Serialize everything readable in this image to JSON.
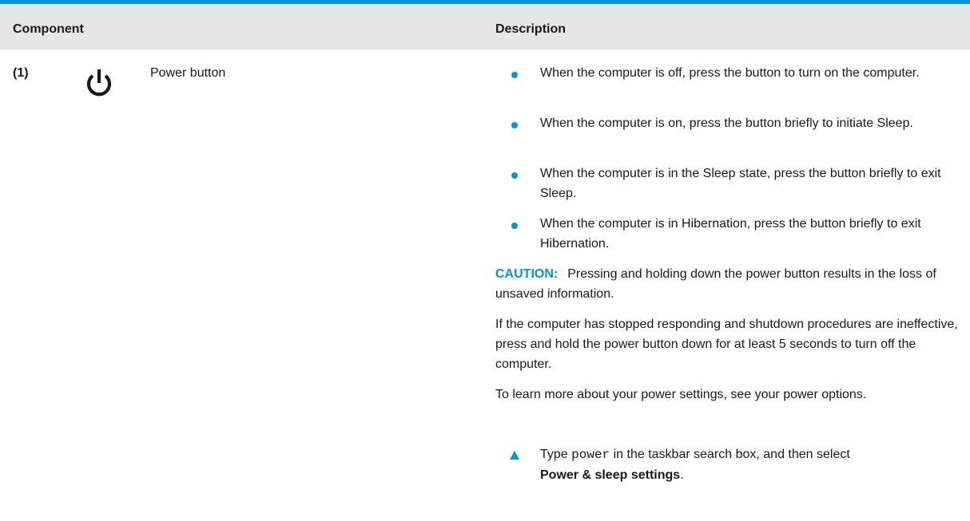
{
  "header": {
    "component": "Component",
    "description": "Description"
  },
  "row": {
    "number": "(1)",
    "icon": "power-icon",
    "name": "Power button",
    "bullets": [
      "When the computer is off, press the button to turn on the computer.",
      "When the computer is on, press the button briefly to initiate Sleep.",
      "When the computer is in the Sleep state, press the button briefly to exit Sleep.",
      "When the computer is in Hibernation, press the button briefly to exit Hibernation."
    ],
    "caution_label": "CAUTION:",
    "caution_text": "Pressing and holding down the power button results in the loss of unsaved information.",
    "para1": "If the computer has stopped responding and shutdown procedures are ineffective, press and hold the power button down for at least 5 seconds to turn off the computer.",
    "para2": "To learn more about your power settings, see your power options.",
    "step": {
      "prefix": "Type",
      "code": "power",
      "middle": "in the taskbar search box, and then select",
      "bold": "Power & sleep settings",
      "suffix": "."
    }
  },
  "colors": {
    "accent": "#0096d6",
    "header_bg": "#e6e6e6"
  }
}
